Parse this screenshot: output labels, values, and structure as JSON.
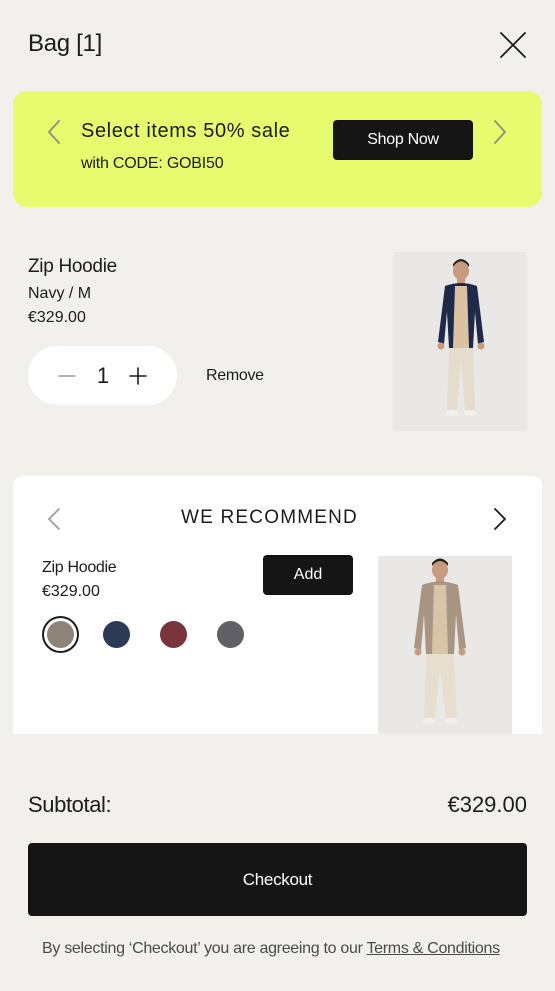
{
  "header": {
    "title": "Bag [1]"
  },
  "promo": {
    "headline": "Select items 50% sale",
    "code_text": "with CODE: GOBI50",
    "button_label": "Shop Now",
    "background": "#e6fb6d"
  },
  "bag_item": {
    "name": "Zip Hoodie",
    "variant": "Navy / M",
    "price": "€329.00",
    "quantity": "1",
    "remove_label": "Remove"
  },
  "recommend": {
    "title": "WE RECOMMEND",
    "product_name": "Zip Hoodie",
    "product_price": "€329.00",
    "add_label": "Add",
    "swatches": [
      {
        "color": "#8d8379",
        "selected": true
      },
      {
        "color": "#2c3a55",
        "selected": false
      },
      {
        "color": "#7a343c",
        "selected": false
      },
      {
        "color": "#606066",
        "selected": false
      }
    ]
  },
  "summary": {
    "subtotal_label": "Subtotal:",
    "subtotal_value": "€329.00",
    "checkout_label": "Checkout",
    "terms_prefix": "By selecting ‘Checkout’ you are agreeing to our ",
    "terms_link": "Terms & Conditions"
  }
}
